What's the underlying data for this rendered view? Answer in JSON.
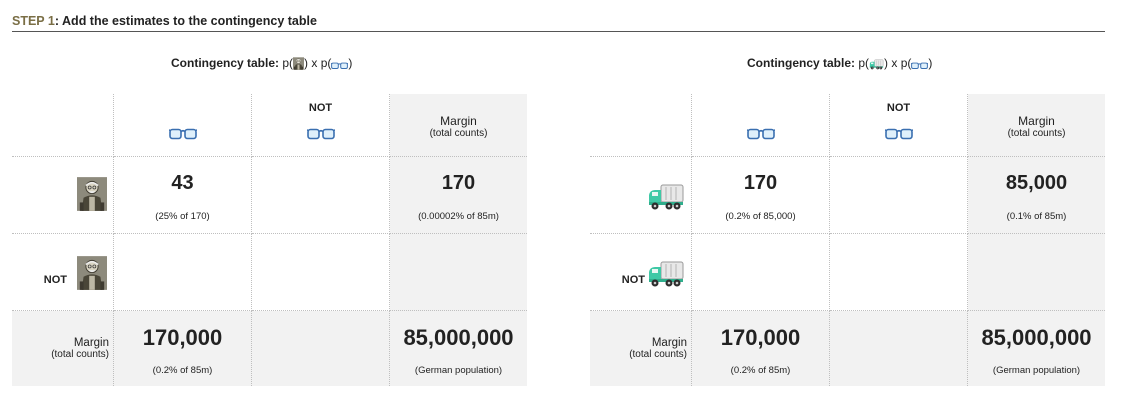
{
  "step": {
    "label": "STEP 1",
    "text": ": Add the estimates to the contingency table"
  },
  "tables": [
    {
      "title_prefix": "Contingency table:",
      "title_p_open": " p(",
      "title_mid": ") x p(",
      "title_close": ")",
      "row_icon": "old-man-icon",
      "col_icon": "glasses-icon",
      "not_label": "NOT",
      "margin_label": "Margin",
      "margin_sub": "(total counts)",
      "cells": {
        "a_value": "43",
        "a_note": "(25% of 170)",
        "row1_margin_value": "170",
        "row1_margin_note": "(0.00002% of 85m)",
        "col1_margin_value": "170,000",
        "col1_margin_note": "(0.2% of 85m)",
        "total_value": "85,000,000",
        "total_note": "(German population)"
      }
    },
    {
      "title_prefix": "Contingency table:",
      "title_p_open": " p(",
      "title_mid": ") x p(",
      "title_close": ")",
      "row_icon": "garbage-truck-icon",
      "col_icon": "glasses-icon",
      "not_label": "NOT",
      "margin_label": "Margin",
      "margin_sub": "(total counts)",
      "cells": {
        "a_value": "170",
        "a_note": "(0.2% of 85,000)",
        "row1_margin_value": "85,000",
        "row1_margin_note": "(0.1% of 85m)",
        "col1_margin_value": "170,000",
        "col1_margin_note": "(0.2% of 85m)",
        "total_value": "85,000,000",
        "total_note": "(German population)"
      }
    }
  ],
  "colors": {
    "step_label": "#7a6e45",
    "margin_bg": "#f2f2f2",
    "glasses": "#3a6fb0",
    "truck": "#3fc9a6"
  }
}
